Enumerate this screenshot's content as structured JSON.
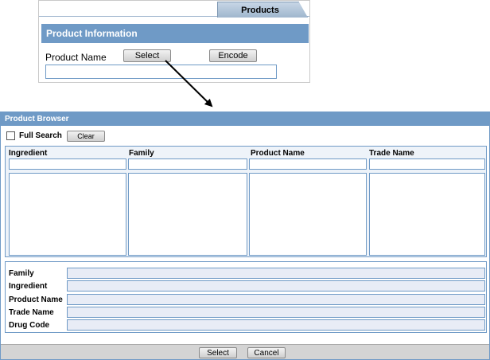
{
  "top": {
    "tab_label": "Products",
    "section_title": "Product Information",
    "product_name_label": "Product Name",
    "select_label": "Select",
    "encode_label": "Encode",
    "product_name_value": ""
  },
  "browser": {
    "title": "Product Browser",
    "full_search_label": "Full Search",
    "full_search_checked": false,
    "clear_label": "Clear",
    "columns": [
      "Ingredient",
      "Family",
      "Product Name",
      "Trade Name"
    ],
    "details": [
      "Family",
      "Ingredient",
      "Product Name",
      "Trade Name",
      "Drug Code"
    ],
    "footer": {
      "select_label": "Select",
      "cancel_label": "Cancel"
    }
  },
  "colors": {
    "accent": "#6f9ac6",
    "header_text": "#ffffff",
    "field_fill": "#e8ecf6",
    "footer_bg": "#d4d4d4"
  }
}
